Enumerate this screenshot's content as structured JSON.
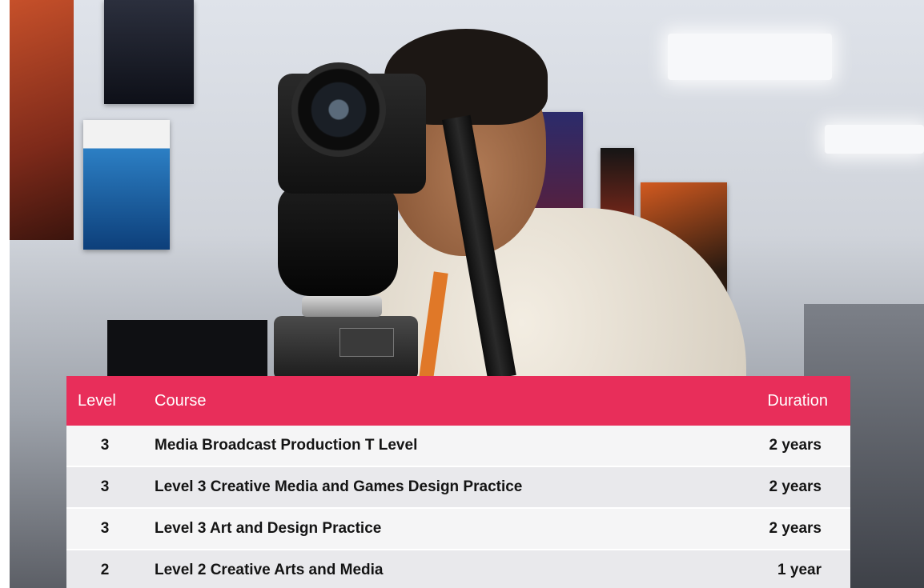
{
  "table": {
    "headers": {
      "level": "Level",
      "course": "Course",
      "duration": "Duration"
    },
    "rows": [
      {
        "level": "3",
        "course": "Media Broadcast Production T Level",
        "duration": "2 years"
      },
      {
        "level": "3",
        "course": "Level 3 Creative Media and Games Design Practice",
        "duration": "2 years"
      },
      {
        "level": "3",
        "course": "Level 3 Art and Design Practice",
        "duration": "2 years"
      },
      {
        "level": "2",
        "course": "Level 2 Creative Arts and Media",
        "duration": "1 year"
      }
    ]
  },
  "colors": {
    "header_background": "#e82e5a",
    "row_light": "#f5f5f6",
    "row_dark": "#e9e9ec"
  }
}
